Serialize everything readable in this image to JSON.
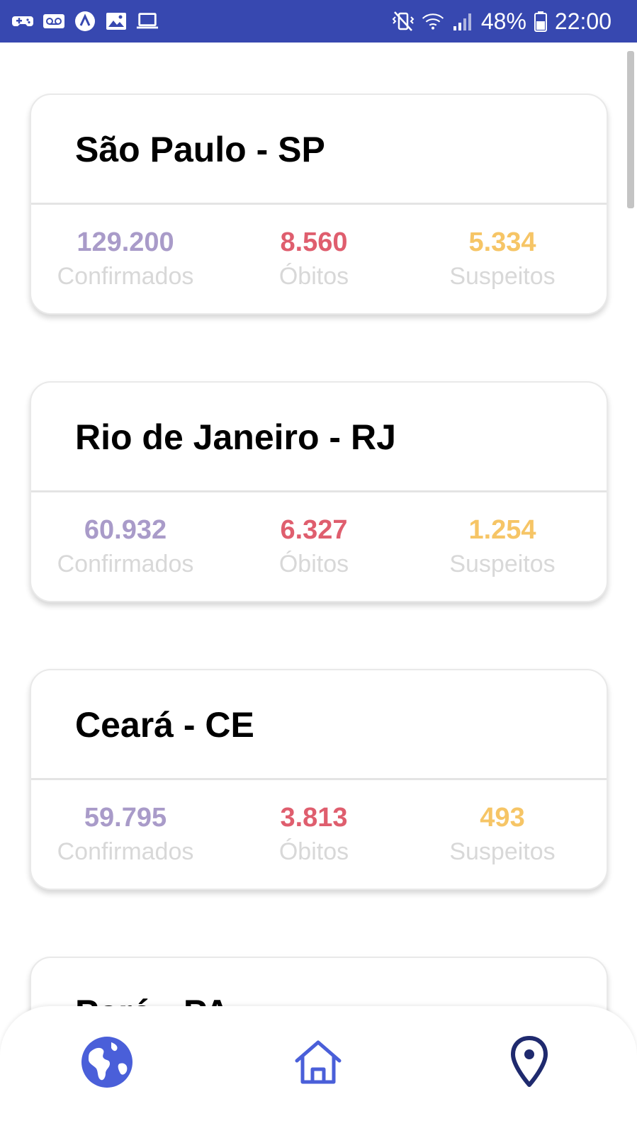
{
  "status_bar": {
    "battery_text": "48%",
    "time": "22:00",
    "icons_left": [
      "game-controller-icon",
      "voicemail-icon",
      "app-a-icon",
      "image-icon",
      "laptop-icon"
    ],
    "icons_right": [
      "vibrate-icon",
      "wifi-icon",
      "signal-icon",
      "battery-icon"
    ]
  },
  "colors": {
    "status_bar": "#3748b0",
    "confirmed": "#a99bc9",
    "deaths": "#df5e6e",
    "suspected": "#f6c566",
    "label": "#d8d8d8",
    "nav_active": "#4a5fd9"
  },
  "cards": [
    {
      "title": "São Paulo - SP",
      "confirmed_value": "129.200",
      "confirmed_label": "Confirmados",
      "deaths_value": "8.560",
      "deaths_label": "Óbitos",
      "suspected_value": "5.334",
      "suspected_label": "Suspeitos"
    },
    {
      "title": "Rio de Janeiro - RJ",
      "confirmed_value": "60.932",
      "confirmed_label": "Confirmados",
      "deaths_value": "6.327",
      "deaths_label": "Óbitos",
      "suspected_value": "1.254",
      "suspected_label": "Suspeitos"
    },
    {
      "title": "Ceará - CE",
      "confirmed_value": "59.795",
      "confirmed_label": "Confirmados",
      "deaths_value": "3.813",
      "deaths_label": "Óbitos",
      "suspected_value": "493",
      "suspected_label": "Suspeitos"
    },
    {
      "title": "Pará - PA"
    }
  ],
  "bottom_nav": {
    "items": [
      "globe-icon",
      "home-icon",
      "location-pin-icon"
    ]
  }
}
